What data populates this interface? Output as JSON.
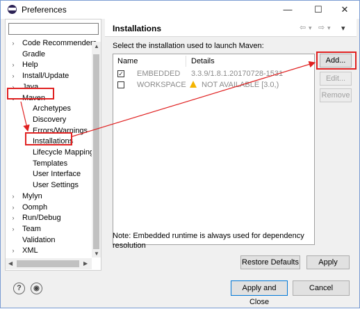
{
  "window": {
    "title": "Preferences",
    "minimize": "—",
    "maximize": "☐",
    "close": "✕"
  },
  "filter": {
    "placeholder": ""
  },
  "tree": [
    {
      "label": "Code Recommenders",
      "expander": "›",
      "level": 0
    },
    {
      "label": "Gradle",
      "expander": "",
      "level": 0
    },
    {
      "label": "Help",
      "expander": "›",
      "level": 0
    },
    {
      "label": "Install/Update",
      "expander": "›",
      "level": 0
    },
    {
      "label": "Java",
      "expander": "›",
      "level": 0
    },
    {
      "label": "Maven",
      "expander": "⌄",
      "level": 0
    },
    {
      "label": "Archetypes",
      "expander": "",
      "level": 1
    },
    {
      "label": "Discovery",
      "expander": "",
      "level": 1
    },
    {
      "label": "Errors/Warnings",
      "expander": "",
      "level": 1
    },
    {
      "label": "Installations",
      "expander": "",
      "level": 1
    },
    {
      "label": "Lifecycle Mapping",
      "expander": "",
      "level": 1
    },
    {
      "label": "Templates",
      "expander": "",
      "level": 1
    },
    {
      "label": "User Interface",
      "expander": "",
      "level": 1
    },
    {
      "label": "User Settings",
      "expander": "",
      "level": 1
    },
    {
      "label": "Mylyn",
      "expander": "›",
      "level": 0
    },
    {
      "label": "Oomph",
      "expander": "›",
      "level": 0
    },
    {
      "label": "Run/Debug",
      "expander": "›",
      "level": 0
    },
    {
      "label": "Team",
      "expander": "›",
      "level": 0
    },
    {
      "label": "Validation",
      "expander": "",
      "level": 0
    },
    {
      "label": "XML",
      "expander": "›",
      "level": 0
    }
  ],
  "page": {
    "title": "Installations",
    "nav": {
      "back": "⇦",
      "back_menu": "▾",
      "forward": "⇨",
      "forward_menu": "▾",
      "view_menu": "▾"
    },
    "subtitle": "Select the installation used to launch Maven:",
    "columns": [
      "Name",
      "Details"
    ],
    "rows": [
      {
        "checked": true,
        "name": "EMBEDDED",
        "details": "3.3.9/1.8.1.20170728-1531",
        "warning": false
      },
      {
        "checked": false,
        "name": "WORKSPACE",
        "details": "NOT AVAILABLE [3.0,)",
        "warning": true
      }
    ],
    "buttons": {
      "add": "Add...",
      "edit": "Edit...",
      "remove": "Remove"
    },
    "note": "Note: Embedded runtime is always used for dependency resolution",
    "restore_defaults": "Restore Defaults",
    "apply": "Apply"
  },
  "footer": {
    "help": "?",
    "import": "◉",
    "apply_close": "Apply and Close",
    "cancel": "Cancel"
  },
  "colors": {
    "annotation": "#e02020",
    "selection_outline": "#e02020"
  }
}
